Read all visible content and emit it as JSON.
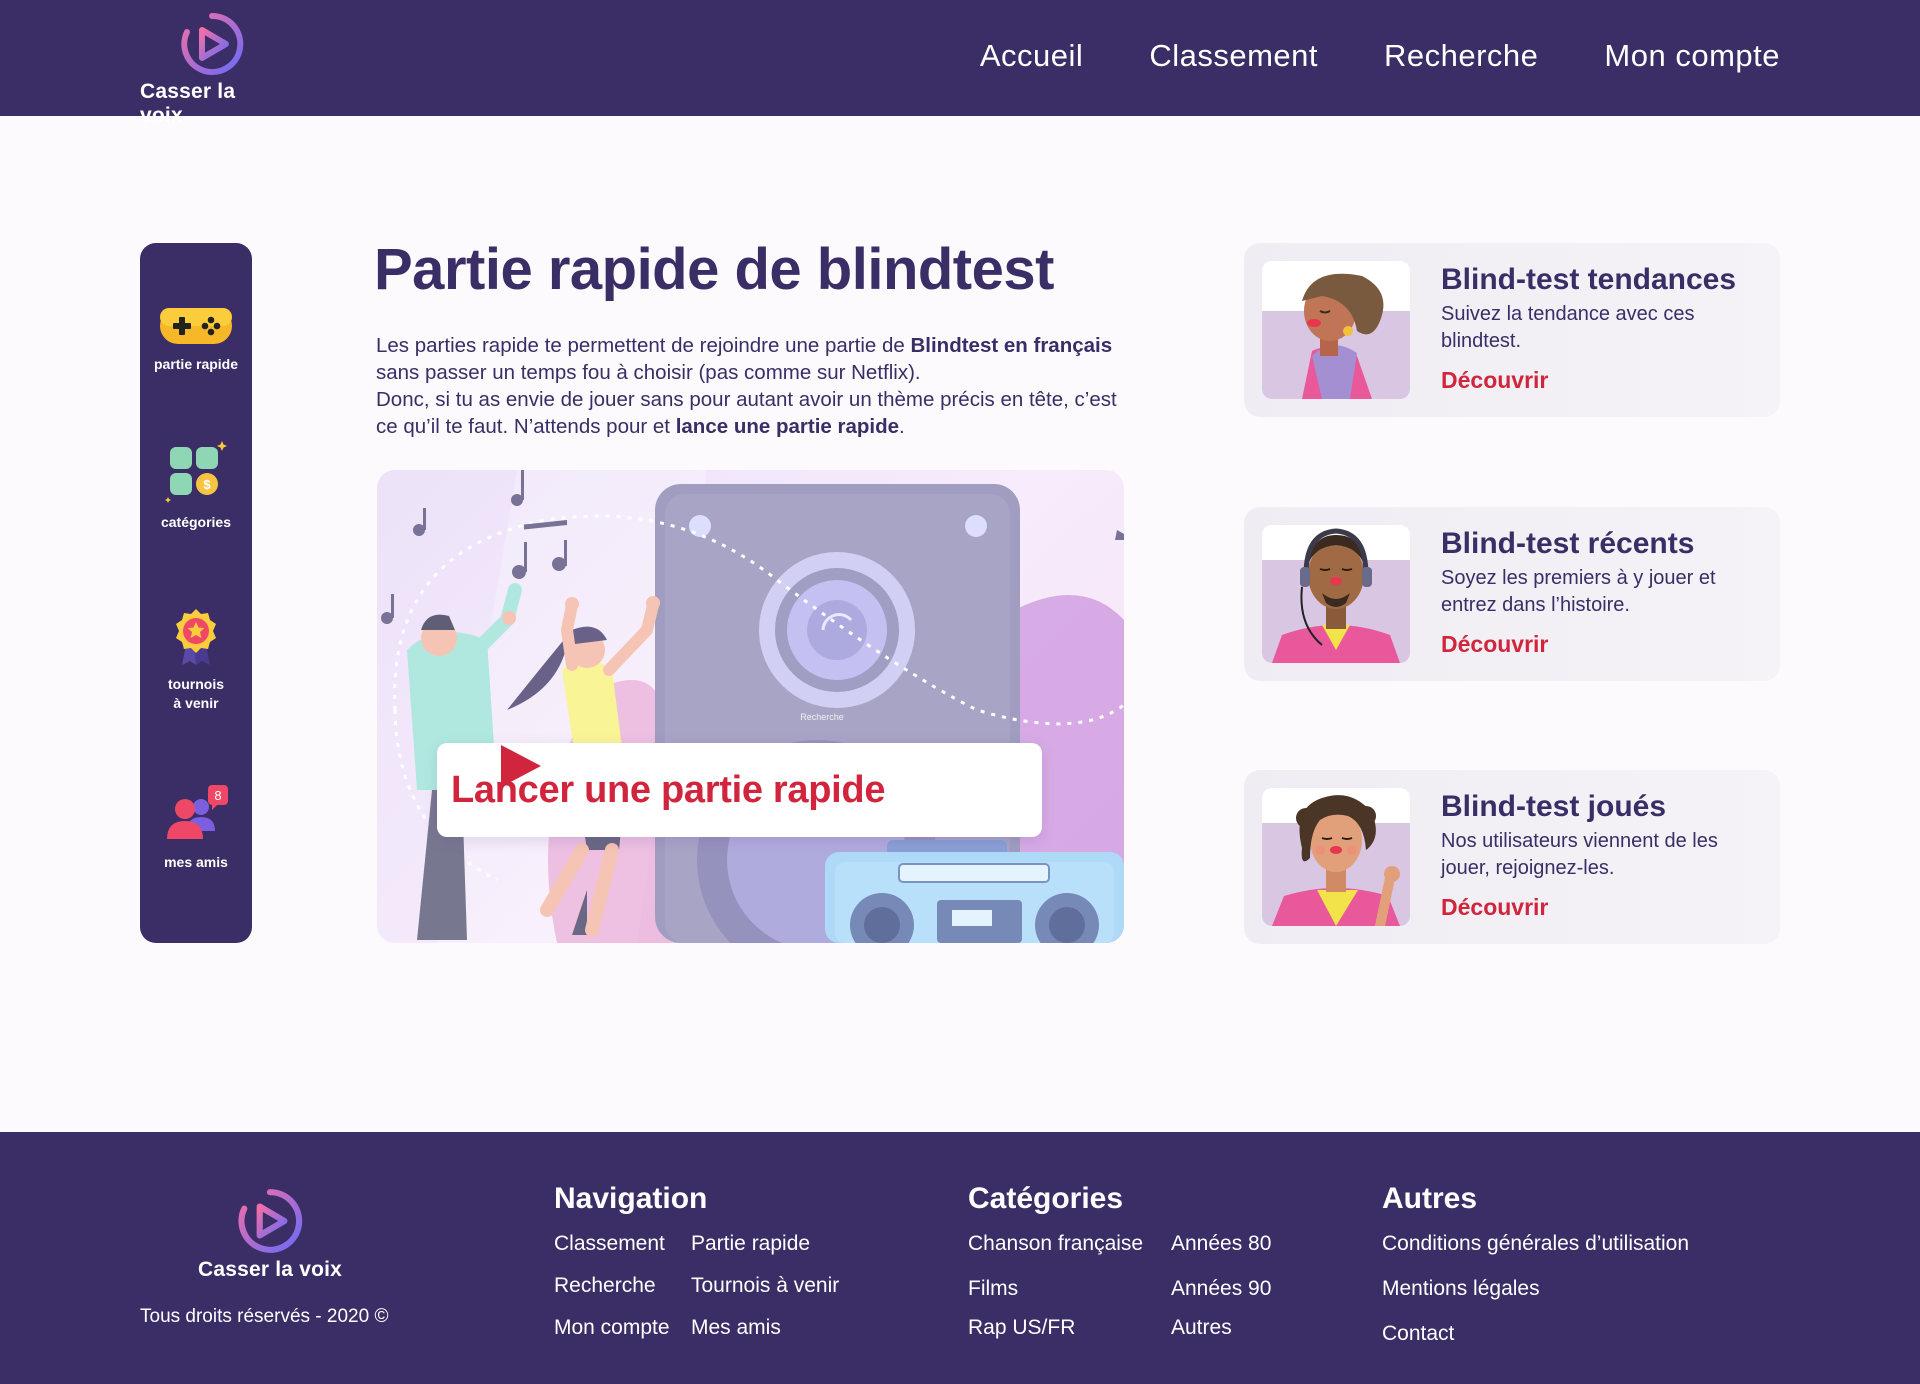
{
  "brand": {
    "name": "Casser la voix"
  },
  "header": {
    "nav": [
      "Accueil",
      "Classement",
      "Recherche",
      "Mon compte"
    ]
  },
  "sidebar": {
    "items": [
      {
        "label": "partie rapide",
        "icon": "gamepad-icon"
      },
      {
        "label": "catégories",
        "icon": "categories-icon"
      },
      {
        "label_line1": "tournois",
        "label_line2": "à venir",
        "icon": "medal-icon"
      },
      {
        "label": "mes amis",
        "icon": "friends-icon"
      }
    ]
  },
  "main": {
    "title": "Partie rapide de blindtest",
    "intro": {
      "p1": "Les parties rapide te permettent de rejoindre une partie de ",
      "b1": "Blindtest en français",
      "p2": " sans passer un temps fou à choisir (pas comme sur Netflix).",
      "p3": "Donc, si tu as envie de jouer sans pour autant avoir un thème précis en tête, c’est ce qu’il te faut. N’attends pour et ",
      "b2": "lance une partie rapide",
      "p4": "."
    },
    "hero": {
      "speaker_label": "Recherche",
      "cta_label": "Lancer une partie rapide"
    }
  },
  "cards": [
    {
      "title": "Blind-test tendances",
      "desc": "Suivez la tendance avec ces blindtest.",
      "link": "Découvrir"
    },
    {
      "title": "Blind-test récents",
      "desc": "Soyez les premiers à y jouer et entrez dans l’histoire.",
      "link": "Découvrir"
    },
    {
      "title": "Blind-test joués",
      "desc": "Nos utilisateurs viennent de les jouer, rejoignez-les.",
      "link": "Découvrir"
    }
  ],
  "footer": {
    "rights": "Tous droits réservés - 2020 ©",
    "navigation": {
      "title": "Navigation",
      "links": [
        "Classement",
        "Partie rapide",
        "Recherche",
        "Tournois à venir",
        "Mon compte",
        "Mes amis"
      ]
    },
    "categories": {
      "title": "Catégories",
      "links": [
        "Chanson française",
        "Années 80",
        "Films",
        "Années 90",
        "Rap US/FR",
        "Autres"
      ]
    },
    "others": {
      "title": "Autres",
      "links": [
        "Conditions générales d’utilisation",
        "Mentions légales",
        "Contact"
      ]
    }
  },
  "colors": {
    "primary": "#3b2d66",
    "accent": "#d1253d",
    "background": "#fdfafd",
    "card": "#f0eef4"
  }
}
